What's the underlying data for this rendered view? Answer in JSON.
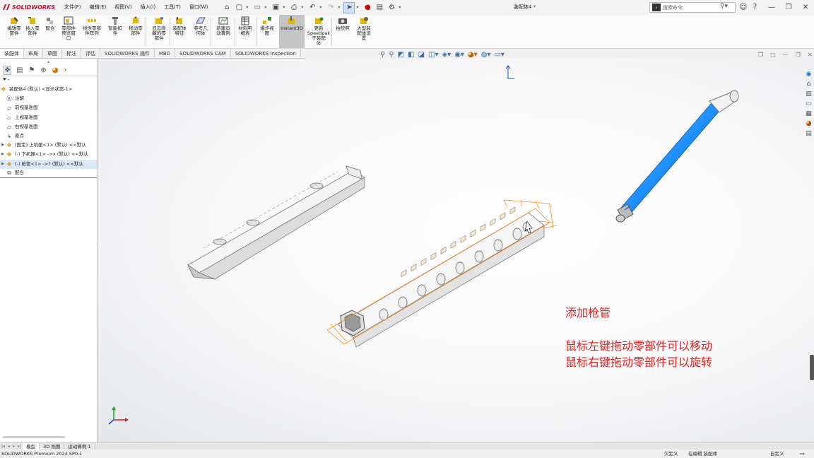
{
  "app": {
    "logo_text": "SOLIDWORKS",
    "document_title": "装配体4 *"
  },
  "menu": [
    "文件(F)",
    "编辑(E)",
    "视图(V)",
    "插入(I)",
    "工具(T)",
    "窗口(W)"
  ],
  "search": {
    "placeholder": "搜索命令"
  },
  "ribbon": {
    "buttons": [
      {
        "label": "编辑零\n部件"
      },
      {
        "label": "插入零\n部件"
      },
      {
        "label": "配合"
      },
      {
        "label": "零部件\n预览窗\n口"
      },
      {
        "label": "线性零部\n件阵列"
      },
      {
        "label": "智能扣\n件"
      },
      {
        "label": "移动零\n部件"
      },
      {
        "label": "显示隐\n藏的零\n部件"
      },
      {
        "label": "装配体\n特征"
      },
      {
        "label": "参考几\n何体"
      },
      {
        "label": "新建运\n动算例"
      },
      {
        "label": "材料明\n细表"
      },
      {
        "label": "爆炸视\n图"
      },
      {
        "label": "Instant3D"
      },
      {
        "label": "更新\nSpeedpak\n子装配\n体"
      },
      {
        "label": "拍快照"
      },
      {
        "label": "大型装\n配体设\n置"
      }
    ]
  },
  "tabs": [
    "装配体",
    "布局",
    "草图",
    "标注",
    "评估",
    "SOLIDWORKS 插件",
    "MBD",
    "SOLIDWORKS CAM",
    "SOLIDWORKS Inspection"
  ],
  "tree": {
    "root": "装配体4 (默认) <显示状态-1>",
    "items": [
      {
        "label": "注解"
      },
      {
        "label": "前视基准面"
      },
      {
        "label": "上视基准面"
      },
      {
        "label": "右视基准面"
      },
      {
        "label": "原点"
      },
      {
        "label": "(固定) 上机匣<1> (默认) <<默认"
      },
      {
        "label": "(-) 下机匣<1> ->x (默认) <<默认"
      },
      {
        "label": "(-) 枪管<1> ->? (默认) <<默认"
      },
      {
        "label": "配合"
      }
    ]
  },
  "annotation": {
    "line1": "添加枪管",
    "line2": "鼠标左键拖动零部件可以移动",
    "line3": "鼠标右键拖动零部件可以旋转"
  },
  "bottom_tabs": [
    "模型",
    "3D 视图",
    "运动算例 1"
  ],
  "status": {
    "left": "SOLIDWORKS Premium 2023 SP0.1",
    "s1": "欠定义",
    "s2": "在编辑 装配体",
    "s3": "自定义"
  },
  "colors": {
    "accent": "#c8102e",
    "barrel": "#1e90ff",
    "annotation": "#e02020",
    "selection_box": "#ff8c1a"
  },
  "icons": [
    "home-icon",
    "new-doc-icon",
    "open-icon",
    "save-icon",
    "print-icon",
    "undo-icon",
    "redo-icon",
    "select-icon",
    "rebuild-icon",
    "options-icon"
  ]
}
